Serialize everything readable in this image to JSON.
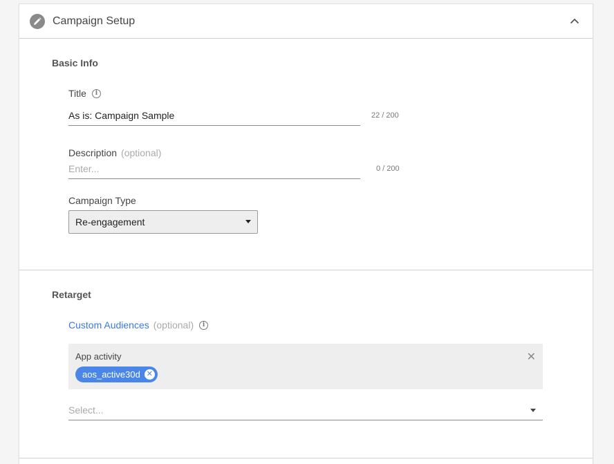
{
  "header": {
    "title": "Campaign Setup",
    "icon": "pencil-icon",
    "collapse_icon": "chevron-up-icon"
  },
  "basic_info": {
    "title": "Basic Info",
    "title_field": {
      "label": "Title",
      "value": "As is: Campaign Sample",
      "counter": "22 / 200"
    },
    "description_field": {
      "label": "Description",
      "optional": "(optional)",
      "placeholder": "Enter...",
      "value": "",
      "counter": "0 / 200"
    },
    "campaign_type": {
      "label": "Campaign Type",
      "selected": "Re-engagement"
    }
  },
  "retarget": {
    "title": "Retarget",
    "custom_audiences": {
      "label": "Custom Audiences",
      "optional": "(optional)"
    },
    "filter": {
      "title": "App activity",
      "chips": [
        "aos_active30d"
      ]
    },
    "select_placeholder": "Select..."
  },
  "colors": {
    "accent": "#4a86e8",
    "link": "#3b78e7"
  }
}
